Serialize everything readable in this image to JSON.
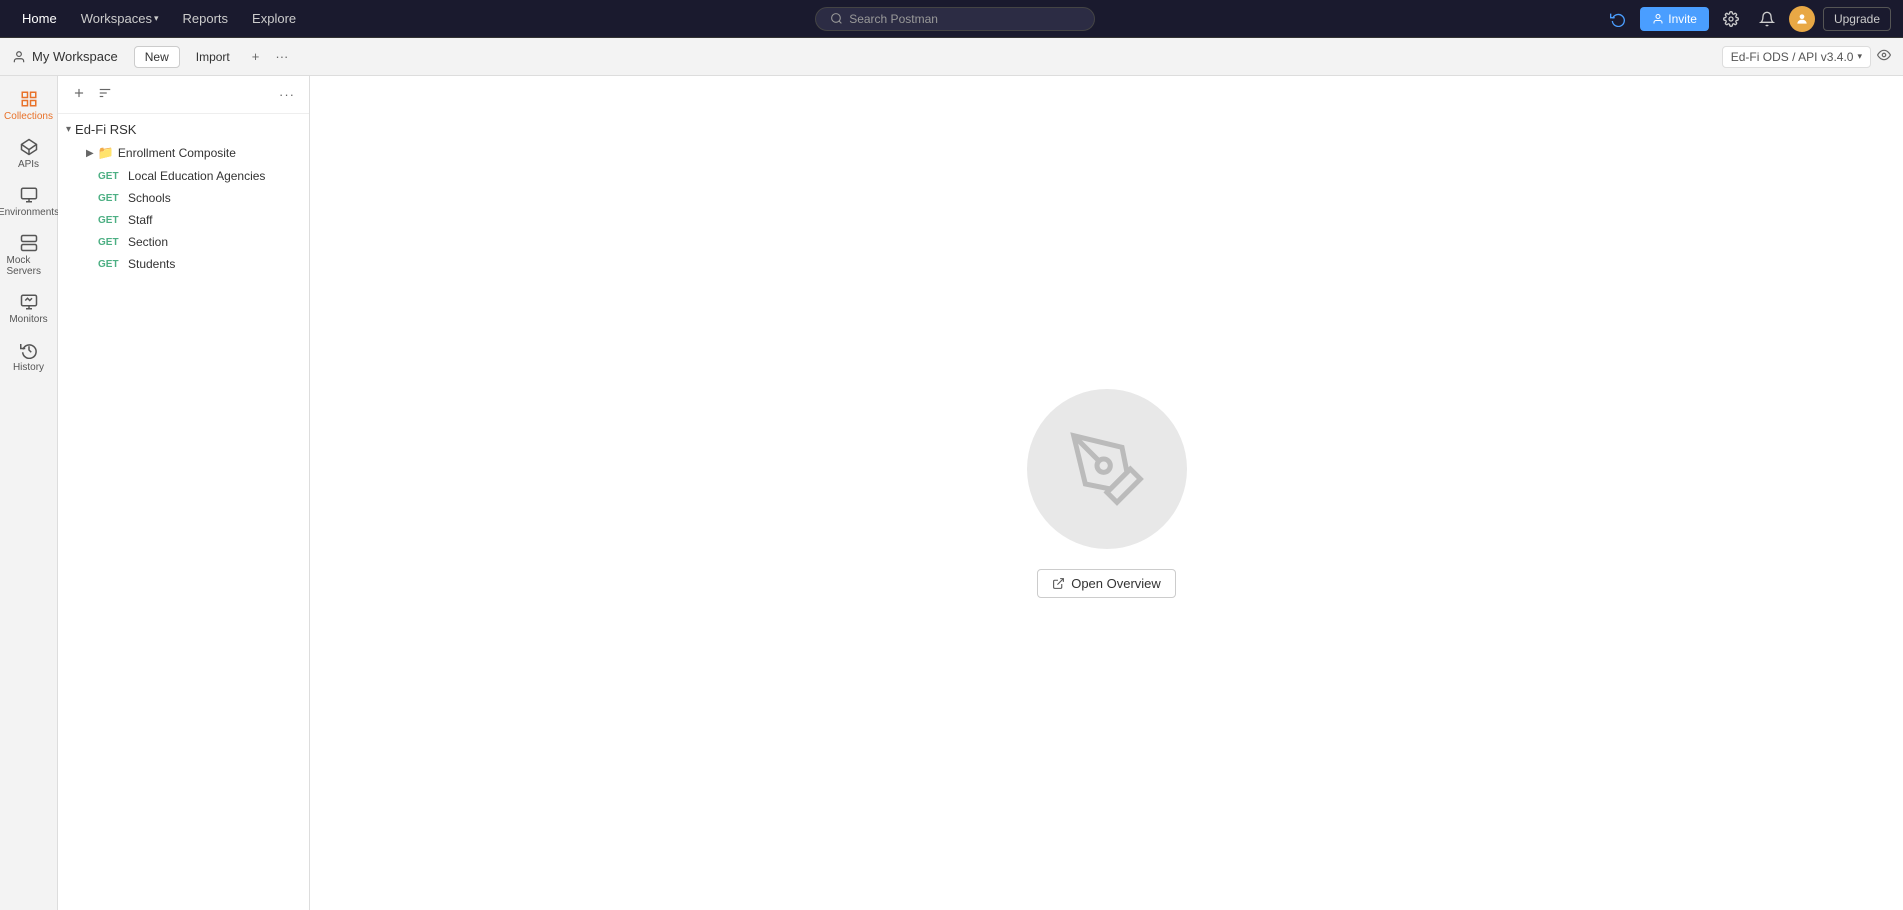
{
  "topnav": {
    "items": [
      {
        "label": "Home",
        "id": "home"
      },
      {
        "label": "Workspaces",
        "id": "workspaces",
        "hasChevron": true
      },
      {
        "label": "Reports",
        "id": "reports"
      },
      {
        "label": "Explore",
        "id": "explore"
      }
    ],
    "search_placeholder": "Search Postman",
    "invite_label": "Invite",
    "upgrade_label": "Upgrade"
  },
  "workspace_bar": {
    "workspace_label": "My Workspace",
    "new_label": "New",
    "import_label": "Import",
    "env_label": "Ed-Fi ODS / API v3.4.0"
  },
  "sidebar": {
    "items": [
      {
        "id": "collections",
        "label": "Collections",
        "icon": "collections-icon"
      },
      {
        "id": "apis",
        "label": "APIs",
        "icon": "apis-icon"
      },
      {
        "id": "environments",
        "label": "Environments",
        "icon": "environments-icon"
      },
      {
        "id": "mock-servers",
        "label": "Mock Servers",
        "icon": "mock-servers-icon"
      },
      {
        "id": "monitors",
        "label": "Monitors",
        "icon": "monitors-icon"
      },
      {
        "id": "history",
        "label": "History",
        "icon": "history-icon"
      }
    ]
  },
  "collection": {
    "root_name": "Ed-Fi RSK",
    "folder": {
      "name": "Enrollment Composite"
    },
    "requests": [
      {
        "method": "GET",
        "name": "Local Education Agencies"
      },
      {
        "method": "GET",
        "name": "Schools"
      },
      {
        "method": "GET",
        "name": "Staff"
      },
      {
        "method": "GET",
        "name": "Section"
      },
      {
        "method": "GET",
        "name": "Students"
      }
    ]
  },
  "main": {
    "open_overview_label": "Open Overview"
  }
}
